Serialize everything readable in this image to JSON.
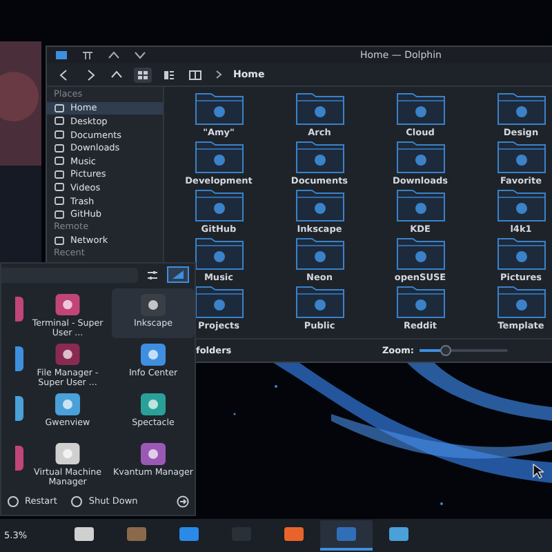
{
  "dolphin": {
    "title": "Home — Dolphin",
    "breadcrumb": "Home",
    "sidebar": [
      {
        "heading": "Places",
        "items": [
          {
            "label": "Home",
            "selected": true
          },
          {
            "label": "Desktop",
            "selected": false
          },
          {
            "label": "Documents",
            "selected": false
          },
          {
            "label": "Downloads",
            "selected": false
          },
          {
            "label": "Music",
            "selected": false
          },
          {
            "label": "Pictures",
            "selected": false
          },
          {
            "label": "Videos",
            "selected": false
          },
          {
            "label": "Trash",
            "selected": false
          },
          {
            "label": "GitHub",
            "selected": false
          }
        ]
      },
      {
        "heading": "Remote",
        "items": [
          {
            "label": "Network",
            "selected": false
          }
        ]
      },
      {
        "heading": "Recent"
      }
    ],
    "folders": [
      {
        "name": "\"Amy\""
      },
      {
        "name": "Arch"
      },
      {
        "name": "Cloud"
      },
      {
        "name": "Design"
      },
      {
        "name": "Development"
      },
      {
        "name": "Documents"
      },
      {
        "name": "Downloads"
      },
      {
        "name": "Favorite"
      },
      {
        "name": "GitHub"
      },
      {
        "name": "Inkscape"
      },
      {
        "name": "KDE"
      },
      {
        "name": "l4k1"
      },
      {
        "name": "Music"
      },
      {
        "name": "Neon"
      },
      {
        "name": "openSUSE"
      },
      {
        "name": "Pictures"
      },
      {
        "name": "Projects"
      },
      {
        "name": "Public"
      },
      {
        "name": "Reddit"
      },
      {
        "name": "Template"
      }
    ],
    "status": "folders",
    "zoom_label": "Zoom:",
    "zoom": {
      "level": 0.3
    }
  },
  "launcher": {
    "apps": [
      {
        "name": "Terminal - Super User ...",
        "selected": false
      },
      {
        "name": "Inkscape",
        "selected": true
      },
      {
        "name": "File Manager - Super User ...",
        "selected": false
      },
      {
        "name": "Info Center",
        "selected": false
      },
      {
        "name": "Gwenview",
        "selected": false
      },
      {
        "name": "Spectacle",
        "selected": false
      },
      {
        "name": "Virtual Machine Manager",
        "selected": false
      },
      {
        "name": "Kvantum Manager",
        "selected": false
      }
    ],
    "actions": [
      "Restart",
      "Shut Down"
    ]
  },
  "taskbar": {
    "reading": "5.3%",
    "items": [
      {
        "selected": false
      },
      {
        "selected": false
      },
      {
        "selected": false
      },
      {
        "selected": false
      },
      {
        "selected": false
      },
      {
        "selected": true
      },
      {
        "selected": false
      }
    ]
  }
}
